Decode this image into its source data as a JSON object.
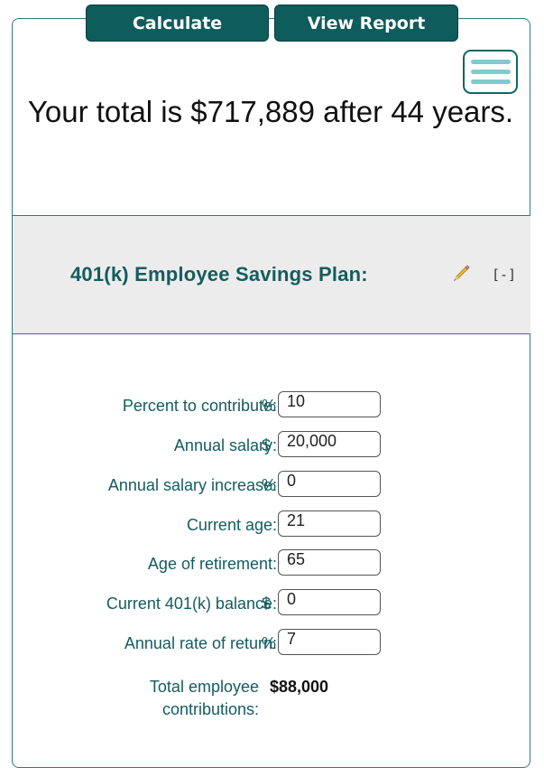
{
  "header": {
    "calculate_label": "Calculate",
    "view_report_label": "View Report"
  },
  "summary": {
    "total_text": "Your total is $717,889 after 44 years."
  },
  "plan": {
    "title": "401(k) Employee Savings Plan:",
    "collapse_label": "[-]"
  },
  "fields": [
    {
      "label": "Percent to contribute:",
      "unit": "%",
      "value": "10"
    },
    {
      "label": "Annual salary:",
      "unit": "$",
      "value": "20,000"
    },
    {
      "label": "Annual salary increase:",
      "unit": "%",
      "value": "0"
    },
    {
      "label": "Current age:",
      "unit": "",
      "value": "21"
    },
    {
      "label": "Age of retirement:",
      "unit": "",
      "value": "65"
    },
    {
      "label": "Current 401(k) balance:",
      "unit": "$",
      "value": "0"
    },
    {
      "label": "Annual rate of return:",
      "unit": "%",
      "value": "7"
    }
  ],
  "totals": {
    "employee_contributions_label": "Total employee contributions:",
    "employee_contributions_value": "$88,000"
  },
  "icons": {
    "menu": "hamburger-menu-icon",
    "edit": "pencil-icon"
  },
  "colors": {
    "primary_button": "#0f5c5c",
    "label_text": "#145c5e",
    "border": "#2f7a82",
    "menu_bars": "#7fcccc",
    "band_background": "#ececec"
  }
}
